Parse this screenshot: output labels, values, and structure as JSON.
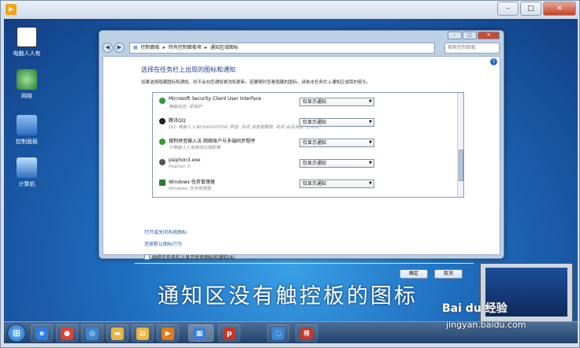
{
  "host": {
    "title": "",
    "app_icon": "app-icon",
    "buttons": [
      "–",
      "□",
      "✕"
    ]
  },
  "desktop": {
    "icons": [
      {
        "label": "电脑人人有",
        "icon": "panda-icon",
        "color": "#1a1a1a"
      },
      {
        "label": "网络",
        "icon": "network-icon",
        "color": "#3b8c3b"
      },
      {
        "label": "控制面板",
        "icon": "control-panel-icon",
        "color": "#3a7fd0"
      },
      {
        "label": "计算机",
        "icon": "computer-icon",
        "color": "#3a7fd0"
      }
    ],
    "caption": "通知区没有触控板的图标"
  },
  "window": {
    "buttons": [
      "–",
      "□",
      "✕"
    ],
    "breadcrumb": [
      "控制面板",
      "所有控制面板项",
      "通知区域图标"
    ],
    "search_placeholder": "搜索控制面板",
    "heading": "选择在任务栏上出现的图标和通知",
    "description": "如果选择隐藏图标和通知，则不会向您通知更改和更新。若要随时查看隐藏的图标，请单击任务栏上通知区域旁的箭头。",
    "items": [
      {
        "name": "Microsoft Security Client User Interface",
        "sub": "电脑状态: 受保护",
        "behavior": "仅显示通知",
        "icon": "security-client-icon",
        "color": "#2f9a3a"
      },
      {
        "name": "腾讯QQ",
        "sub": "QQ: 电脑人人有(300020534)  声音: 关闭  消息提醒框: 关闭  会话消息: 任务栏...",
        "behavior": "仅显示通知",
        "icon": "qq-icon",
        "color": "#222222"
      },
      {
        "name": "搜狗拼音输入法 网络账户与多端同步程序",
        "sub": "为电脑人人有提供云端配置",
        "behavior": "仅显示通知",
        "icon": "sogou-icon",
        "color": "#2f9a3a"
      },
      {
        "name": "psiphon3.exe",
        "sub": "Psiphon 3",
        "behavior": "仅显示通知",
        "icon": "psiphon-icon",
        "color": "#555555"
      },
      {
        "name": "Windows 任务管理器",
        "sub": "Windows 任务管理器",
        "behavior": "仅显示通知",
        "icon": "task-manager-icon",
        "color": "#2f7a2f"
      }
    ],
    "link_system_icons": "打开或关闭系统图标",
    "link_restore": "还原默认图标行为",
    "checkbox_label": "始终在任务栏上显示所有图标和通知(A)",
    "ok": "确定",
    "cancel": "取消"
  },
  "taskbar": {
    "items": [
      {
        "icon": "internet-explorer-icon",
        "color": "#2b7de0",
        "glyph": "e"
      },
      {
        "icon": "chrome-icon",
        "color": "#d84332",
        "glyph": "●"
      },
      {
        "icon": "browser-icon",
        "color": "#3a86d1",
        "glyph": "◎"
      },
      {
        "icon": "folder-icon",
        "color": "#e8b640",
        "glyph": "▬"
      },
      {
        "icon": "explorer-icon",
        "color": "#e8b640",
        "glyph": "▤"
      },
      {
        "icon": "media-player-icon",
        "color": "#e07b1c",
        "glyph": "▶"
      },
      {
        "icon": "control-panel-icon",
        "color": "#3a7fd0",
        "glyph": "▦"
      },
      {
        "icon": "psiphon-icon",
        "color": "#c0392b",
        "glyph": "p"
      },
      {
        "icon": "network-icon",
        "color": "#3a86d1",
        "glyph": "◌"
      },
      {
        "icon": "special-char-icon",
        "color": "#c0392b",
        "glyph": "将"
      }
    ]
  },
  "watermark": {
    "brand": "Bai du 经验",
    "url": "jingyan.baidu.com"
  }
}
